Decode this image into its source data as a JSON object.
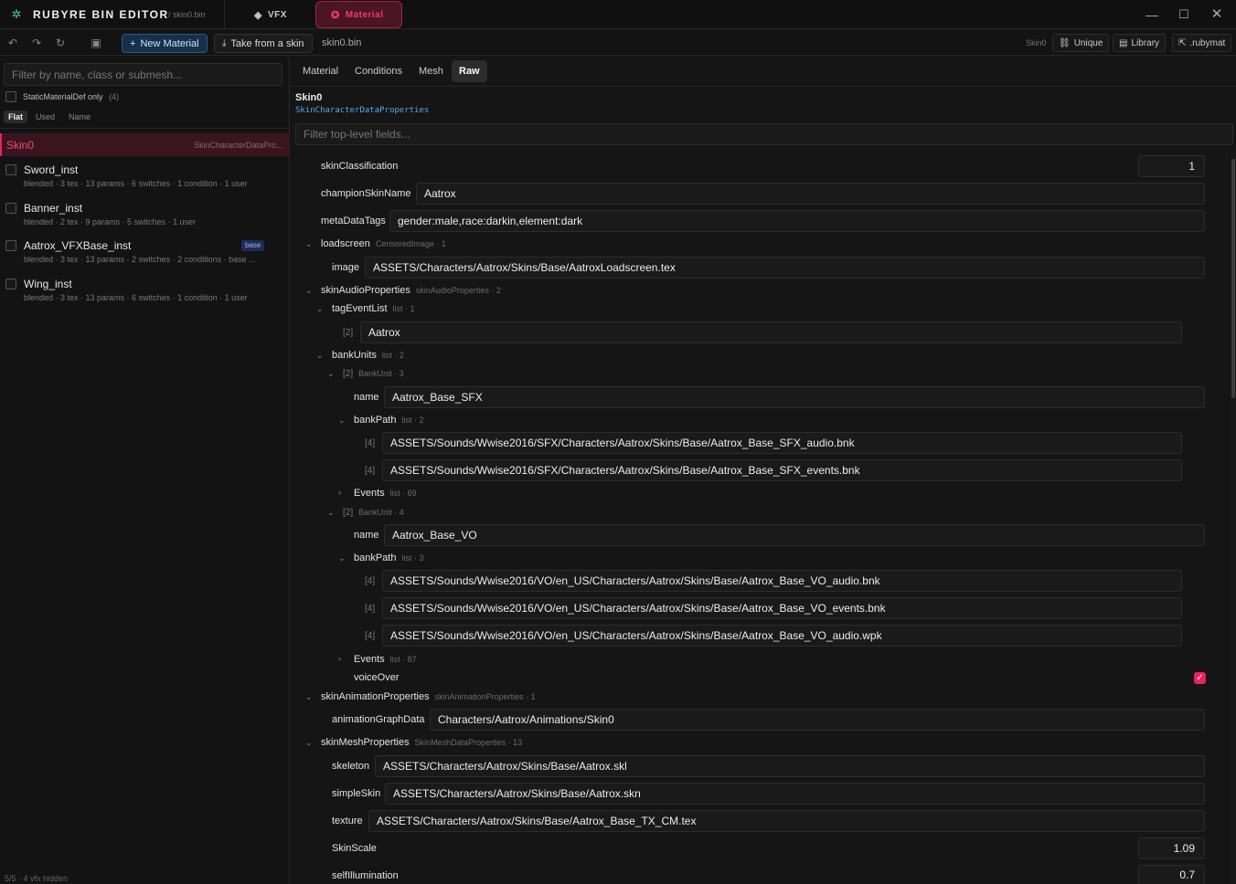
{
  "app": {
    "title": "RUBYRE BIN EDITOR",
    "file_path": "/ skin0.bin",
    "accent": "#e5245f"
  },
  "tabs": [
    {
      "label": "VFX"
    },
    {
      "label": "Material"
    }
  ],
  "toolbar": {
    "new_material": "New Material",
    "take_from_skin": "Take from a skin",
    "file": "skin0.bin",
    "skin_label": "Skin0",
    "unique": "Unique",
    "library": "Library",
    "rubymat": ".rubymat"
  },
  "sidebar": {
    "filter_placeholder": "Filter by name, class or submesh...",
    "static_only": "StaticMaterialDef only",
    "static_count": "(4)",
    "modes": [
      "Flat",
      "Used",
      "Name"
    ],
    "selected": {
      "name": "Skin0",
      "class": "SkinCharacterDataPro..."
    },
    "items": [
      {
        "name": "Sword_inst",
        "sub": "blended · 3 tex · 13 params · 6 switches · 1 condition · 1 user"
      },
      {
        "name": "Banner_inst",
        "sub": "blended · 2 tex · 9 params · 5 switches · 1 user"
      },
      {
        "name": "Aatrox_VFXBase_inst",
        "badge": "base",
        "sub": "blended · 3 tex · 13 params · 2 switches · 2 conditions · base ..."
      },
      {
        "name": "Wing_inst",
        "sub": "blended · 3 tex · 13 params · 6 switches · 1 condition · 1 user"
      }
    ],
    "footer": "5/5 · 4 vfx hidden"
  },
  "main": {
    "tabs": [
      "Material",
      "Conditions",
      "Mesh",
      "Raw"
    ],
    "active_tab": "Raw",
    "entry_name": "Skin0",
    "entry_class": "SkinCharacterDataProperties",
    "filter_placeholder": "Filter top-level fields..."
  },
  "fields": {
    "skinClassification": {
      "label": "skinClassification",
      "value": "1"
    },
    "championSkinName": {
      "label": "championSkinName",
      "value": "Aatrox"
    },
    "metaDataTags": {
      "label": "metaDataTags",
      "value": "gender:male,race:darkin,element:dark"
    },
    "loadscreen": {
      "label": "loadscreen",
      "meta": "CensoredImage · 1"
    },
    "image": {
      "label": "image",
      "value": "ASSETS/Characters/Aatrox/Skins/Base/AatroxLoadscreen.tex"
    },
    "skinAudioProperties": {
      "label": "skinAudioProperties",
      "meta": "skinAudioProperties · 2"
    },
    "tagEventList": {
      "label": "tagEventList",
      "meta": "list · 1",
      "idx": "[2]",
      "value": "Aatrox"
    },
    "bankUnits": {
      "label": "bankUnits",
      "meta": "list · 2"
    },
    "bankUnit1": {
      "idx": "[2]",
      "meta": "BankUnit · 3",
      "name_label": "name",
      "name": "Aatrox_Base_SFX",
      "bankPath_label": "bankPath",
      "bankPath_meta": "list · 2",
      "paths": [
        {
          "idx": "[4]",
          "value": "ASSETS/Sounds/Wwise2016/SFX/Characters/Aatrox/Skins/Base/Aatrox_Base_SFX_audio.bnk"
        },
        {
          "idx": "[4]",
          "value": "ASSETS/Sounds/Wwise2016/SFX/Characters/Aatrox/Skins/Base/Aatrox_Base_SFX_events.bnk"
        }
      ],
      "events_label": "Events",
      "events_meta": "list · 69"
    },
    "bankUnit2": {
      "idx": "[2]",
      "meta": "BankUnit · 4",
      "name_label": "name",
      "name": "Aatrox_Base_VO",
      "bankPath_label": "bankPath",
      "bankPath_meta": "list · 3",
      "paths": [
        {
          "idx": "[4]",
          "value": "ASSETS/Sounds/Wwise2016/VO/en_US/Characters/Aatrox/Skins/Base/Aatrox_Base_VO_audio.bnk"
        },
        {
          "idx": "[4]",
          "value": "ASSETS/Sounds/Wwise2016/VO/en_US/Characters/Aatrox/Skins/Base/Aatrox_Base_VO_events.bnk"
        },
        {
          "idx": "[4]",
          "value": "ASSETS/Sounds/Wwise2016/VO/en_US/Characters/Aatrox/Skins/Base/Aatrox_Base_VO_audio.wpk"
        }
      ],
      "events_label": "Events",
      "events_meta": "list · 87",
      "voiceOver_label": "voiceOver",
      "voiceOver": true
    },
    "skinAnimationProperties": {
      "label": "skinAnimationProperties",
      "meta": "skinAnimationProperties · 1"
    },
    "animationGraphData": {
      "label": "animationGraphData",
      "value": "Characters/Aatrox/Animations/Skin0"
    },
    "skinMeshProperties": {
      "label": "skinMeshProperties",
      "meta": "SkinMeshDataProperties · 13"
    },
    "skeleton": {
      "label": "skeleton",
      "value": "ASSETS/Characters/Aatrox/Skins/Base/Aatrox.skl"
    },
    "simpleSkin": {
      "label": "simpleSkin",
      "value": "ASSETS/Characters/Aatrox/Skins/Base/Aatrox.skn"
    },
    "texture": {
      "label": "texture",
      "value": "ASSETS/Characters/Aatrox/Skins/Base/Aatrox_Base_TX_CM.tex"
    },
    "SkinScale": {
      "label": "SkinScale",
      "value": "1.09"
    },
    "selfIllumination": {
      "label": "selfIllumination",
      "value": "0.7"
    }
  }
}
